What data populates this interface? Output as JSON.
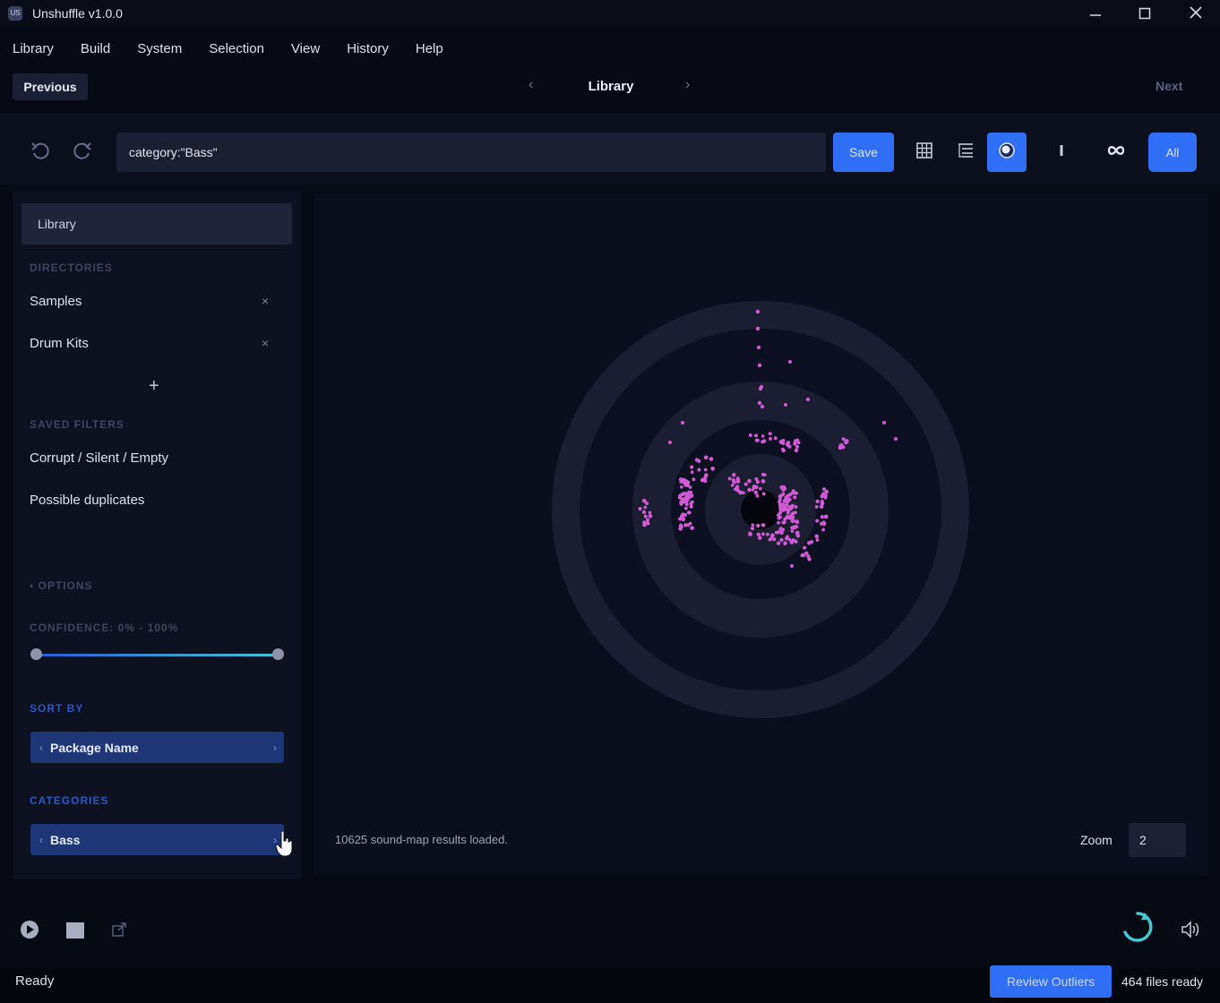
{
  "window": {
    "title": "Unshuffle v1.0.0",
    "icon_text": "US",
    "minimize_icon": "minimize-icon",
    "maximize_icon": "maximize-icon",
    "close_icon": "close-icon"
  },
  "menu": [
    "Library",
    "Build",
    "System",
    "Selection",
    "View",
    "History",
    "Help"
  ],
  "nav": {
    "previous_label": "Previous",
    "title": "Library",
    "next_label": "Next",
    "left_arrow": "‹",
    "right_arrow": "›"
  },
  "toolbar": {
    "undo_icon": "undo-icon",
    "redo_icon": "redo-icon",
    "query": "category:\"Bass\"",
    "save_label": "Save",
    "view_modes": [
      "grid-icon",
      "tree-list-icon",
      "sound-map-icon",
      "bar-icon",
      "infinity-icon"
    ],
    "active_view": "sound-map-icon",
    "all_label": "All",
    "accent_color": "#2f6ef5"
  },
  "sidebar": {
    "header": "Library",
    "directories_label": "DIRECTORIES",
    "directories": [
      "Samples",
      "Drum Kits"
    ],
    "add_symbol": "+",
    "remove_symbol": "×",
    "saved_filters_label": "SAVED FILTERS",
    "saved_filters": [
      "Corrupt / Silent / Empty",
      "Possible duplicates"
    ],
    "options_label": "• OPTIONS",
    "confidence_label": "CONFIDENCE: 0% - 100%",
    "confidence_range": [
      0,
      100
    ],
    "sort_by_label": "SORT BY",
    "sort_by_value": "Package Name",
    "categories_label": "CATEGORIES",
    "category_value": "Bass",
    "chevron_left": "‹",
    "chevron_right": "›"
  },
  "main": {
    "status_message": "10625 sound-map results loaded.",
    "zoom_label": "Zoom",
    "zoom_value": "2",
    "point_color": "#d35ad6"
  },
  "player": {
    "play_icon": "play-icon",
    "stop_icon": "stop-icon",
    "export_icon": "export-icon",
    "loading_icon": "loading-spinner-icon",
    "volume_icon": "volume-icon"
  },
  "statusbar": {
    "ready": "Ready",
    "review_label": "Review Outliers",
    "files_ready": "464 files ready"
  }
}
